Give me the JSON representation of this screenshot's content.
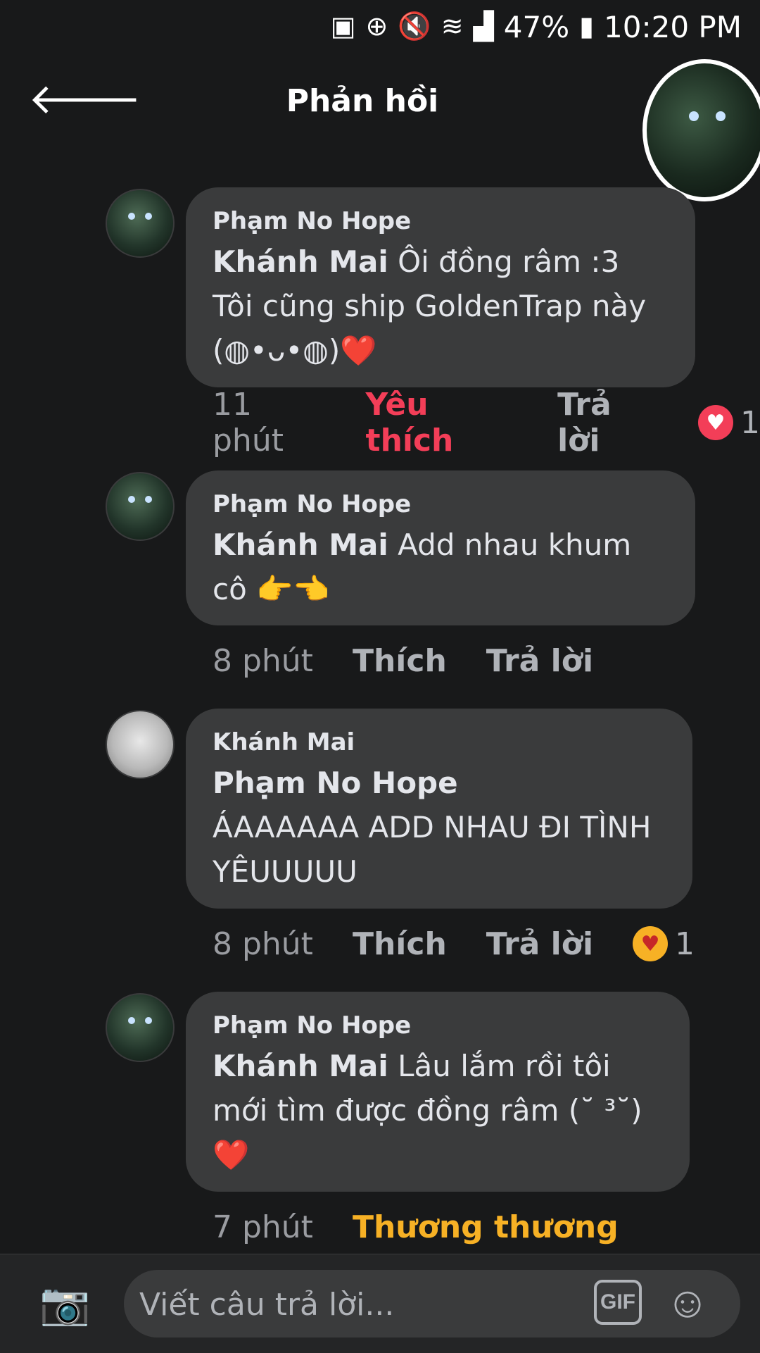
{
  "status_bar": {
    "battery": "47%",
    "time": "10:20 PM",
    "icons": [
      "storage-icon",
      "data-saver-icon",
      "mute-icon",
      "wifi-icon",
      "signal-icon",
      "battery-icon"
    ]
  },
  "header": {
    "title": "Phản hồi",
    "back_icon": "back-arrow-icon"
  },
  "comments": [
    {
      "author": "Phạm No Hope",
      "mention": "Khánh Mai",
      "text": " Ôi đồng râm :3 Tôi cũng ship GoldenTrap này (◍•ᴗ•◍)❤️",
      "time": "11 phút",
      "like_label": "Yêu thích",
      "reply_label": "Trả lời",
      "reaction": "heart",
      "reaction_count": "1"
    },
    {
      "author": "Phạm No Hope",
      "mention": "Khánh Mai",
      "text": " Add nhau khum cô 👉👈",
      "time": "8 phút",
      "like_label": "Thích",
      "reply_label": "Trả lời"
    },
    {
      "author": "Khánh Mai",
      "mention": "Phạm No Hope",
      "text": "ÁAAAAAA ADD NHAU ĐI TÌNH YÊUUUUU",
      "time": "8 phút",
      "like_label": "Thích",
      "reply_label": "Trả lời",
      "reaction": "care",
      "reaction_count": "1"
    },
    {
      "author": "Phạm No Hope",
      "mention": "Khánh Mai",
      "text": " Lâu lắm rồi tôi mới tìm được đồng râm (˘ ³˘)❤️",
      "time": "7 phút",
      "like_label": "Thương thương"
    }
  ],
  "composer": {
    "placeholder": "Viết câu trả lời...",
    "gif_label": "GIF"
  },
  "colors": {
    "background": "#18191a",
    "bubble": "#3a3b3c",
    "love": "#f33e58",
    "care": "#f7b125"
  }
}
